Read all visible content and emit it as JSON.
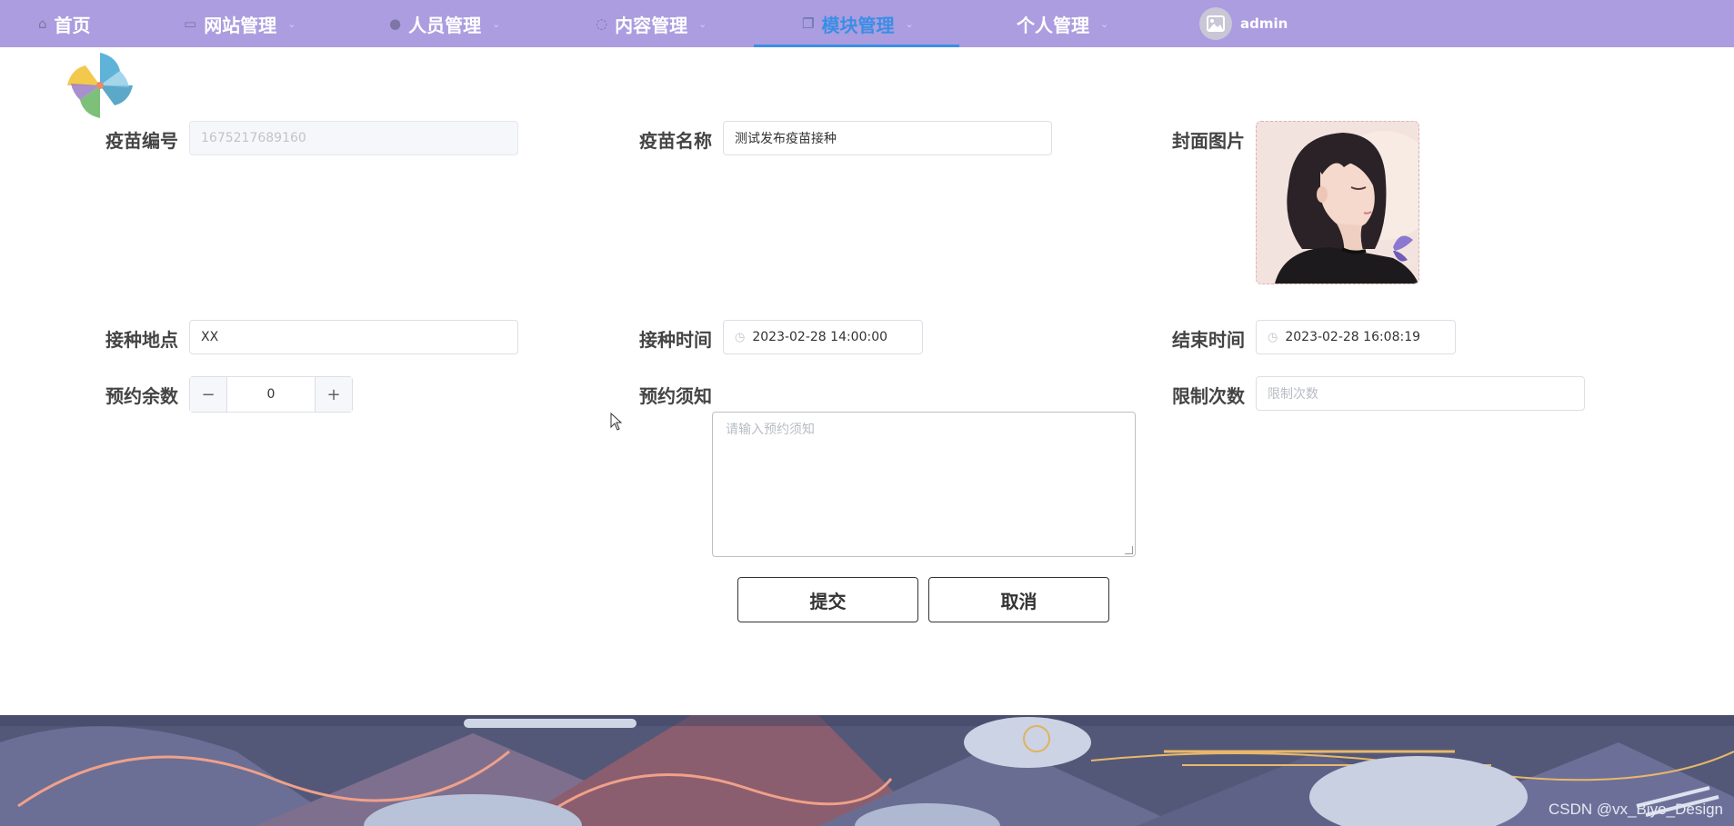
{
  "nav": {
    "items": [
      {
        "label": "首页",
        "icon": "home-icon"
      },
      {
        "label": "网站管理",
        "icon": "monitor-icon"
      },
      {
        "label": "人员管理",
        "icon": "user-icon"
      },
      {
        "label": "内容管理",
        "icon": "chat-icon"
      },
      {
        "label": "模块管理",
        "icon": "copy-icon",
        "active": true
      },
      {
        "label": "个人管理"
      }
    ],
    "username": "admin",
    "active_color": "#3a8ee6",
    "bg_color": "#ab9ddf"
  },
  "form": {
    "vaccine_id": {
      "label": "疫苗编号",
      "value": "1675217689160"
    },
    "vaccine_name": {
      "label": "疫苗名称",
      "value": "测试发布疫苗接种"
    },
    "cover": {
      "label": "封面图片"
    },
    "location": {
      "label": "接种地点",
      "value": "XX"
    },
    "start_time": {
      "label": "接种时间",
      "value": "2023-02-28 14:00:00"
    },
    "end_time": {
      "label": "结束时间",
      "value": "2023-02-28 16:08:19"
    },
    "remaining": {
      "label": "预约余数",
      "value": "0"
    },
    "notice": {
      "label": "预约须知",
      "placeholder": "请输入预约须知"
    },
    "limit": {
      "label": "限制次数",
      "placeholder": "限制次数"
    },
    "submit_label": "提交",
    "cancel_label": "取消"
  },
  "watermark": "CSDN @vx_Biye_Design"
}
